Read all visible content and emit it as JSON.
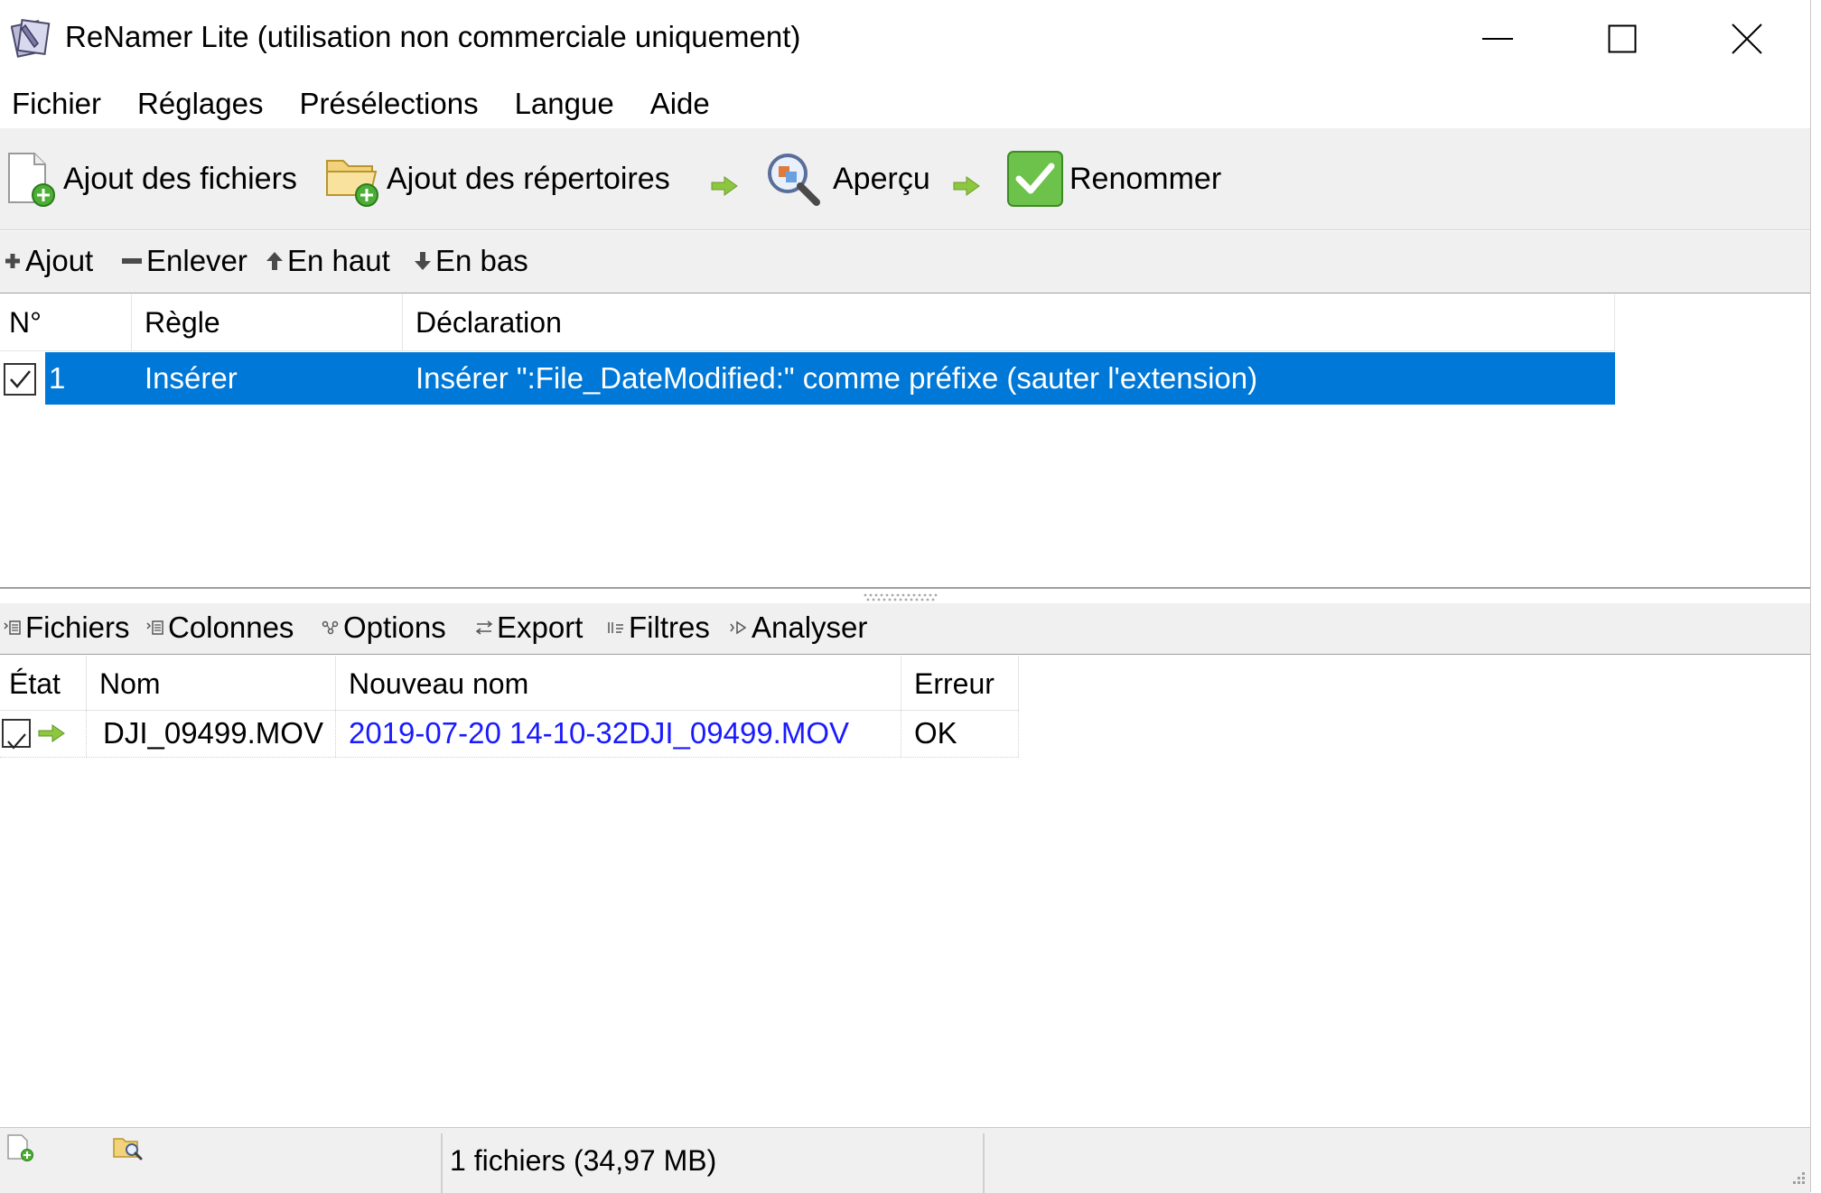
{
  "window": {
    "title": "ReNamer Lite (utilisation non commerciale uniquement)"
  },
  "menu": [
    {
      "label": "Fichier"
    },
    {
      "label": "Réglages"
    },
    {
      "label": "Présélections"
    },
    {
      "label": "Langue"
    },
    {
      "label": "Aide"
    }
  ],
  "toolbar": {
    "add_files": "Ajout des fichiers",
    "add_folders": "Ajout des répertoires",
    "preview": "Aperçu",
    "rename": "Renommer"
  },
  "rules_toolbar": {
    "add": "Ajout",
    "remove": "Enlever",
    "up": "En haut",
    "down": "En bas"
  },
  "rules": {
    "columns": [
      "N°",
      "Règle",
      "Déclaration"
    ],
    "rows": [
      {
        "checked": true,
        "number": "1",
        "rule": "Insérer",
        "statement": "Insérer \":File_DateModified:\" comme préfixe (sauter l'extension)"
      }
    ]
  },
  "files_toolbar": {
    "files": "Fichiers",
    "columns": "Colonnes",
    "options": "Options",
    "export": "Export",
    "filters": "Filtres",
    "analyze": "Analyser"
  },
  "files": {
    "columns": [
      "État",
      "Nom",
      "Nouveau nom",
      "Erreur"
    ],
    "rows": [
      {
        "checked": true,
        "name": "DJI_09499.MOV",
        "new_name": "2019-07-20 14-10-32DJI_09499.MOV",
        "error": "OK"
      }
    ]
  },
  "status": {
    "summary": "1 fichiers (34,97 MB)"
  },
  "colors": {
    "selection": "#0078d7",
    "new_name": "#1a1aff",
    "toolbar_bg": "#f0f0f0",
    "arrow_green": "#8dc63f"
  }
}
